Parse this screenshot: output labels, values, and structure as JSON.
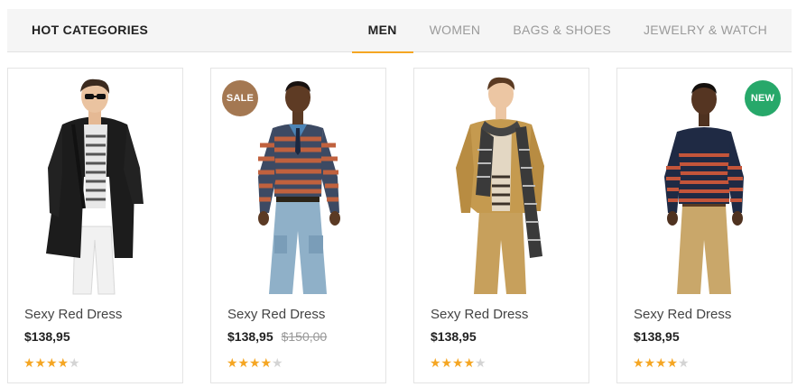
{
  "header": {
    "title": "HOT CATEGORIES",
    "tabs": [
      {
        "label": "MEN",
        "active": true
      },
      {
        "label": "WOMEN",
        "active": false
      },
      {
        "label": "BAGS & SHOES",
        "active": false
      },
      {
        "label": "JEWELRY & WATCH",
        "active": false
      }
    ]
  },
  "colors": {
    "accent": "#f5a623",
    "sale_badge": "#a47852",
    "new_badge": "#27a86a",
    "star_filled": "#f5a623",
    "star_empty": "#d4d4d4"
  },
  "products": [
    {
      "name": "Sexy Red Dress",
      "price": "$138,95",
      "old_price": "",
      "badge": "",
      "rating": 4,
      "rating_max": 5,
      "image": "man-black-coat"
    },
    {
      "name": "Sexy Red Dress",
      "price": "$138,95",
      "old_price": "$150,00",
      "badge": "SALE",
      "rating": 4,
      "rating_max": 5,
      "image": "man-striped-sweater-cargo-jeans"
    },
    {
      "name": "Sexy Red Dress",
      "price": "$138,95",
      "old_price": "",
      "badge": "",
      "rating": 4,
      "rating_max": 5,
      "image": "man-tan-jacket-scarf"
    },
    {
      "name": "Sexy Red Dress",
      "price": "$138,95",
      "old_price": "",
      "badge": "NEW",
      "rating": 4,
      "rating_max": 5,
      "image": "man-striped-sweater-khakis"
    }
  ]
}
